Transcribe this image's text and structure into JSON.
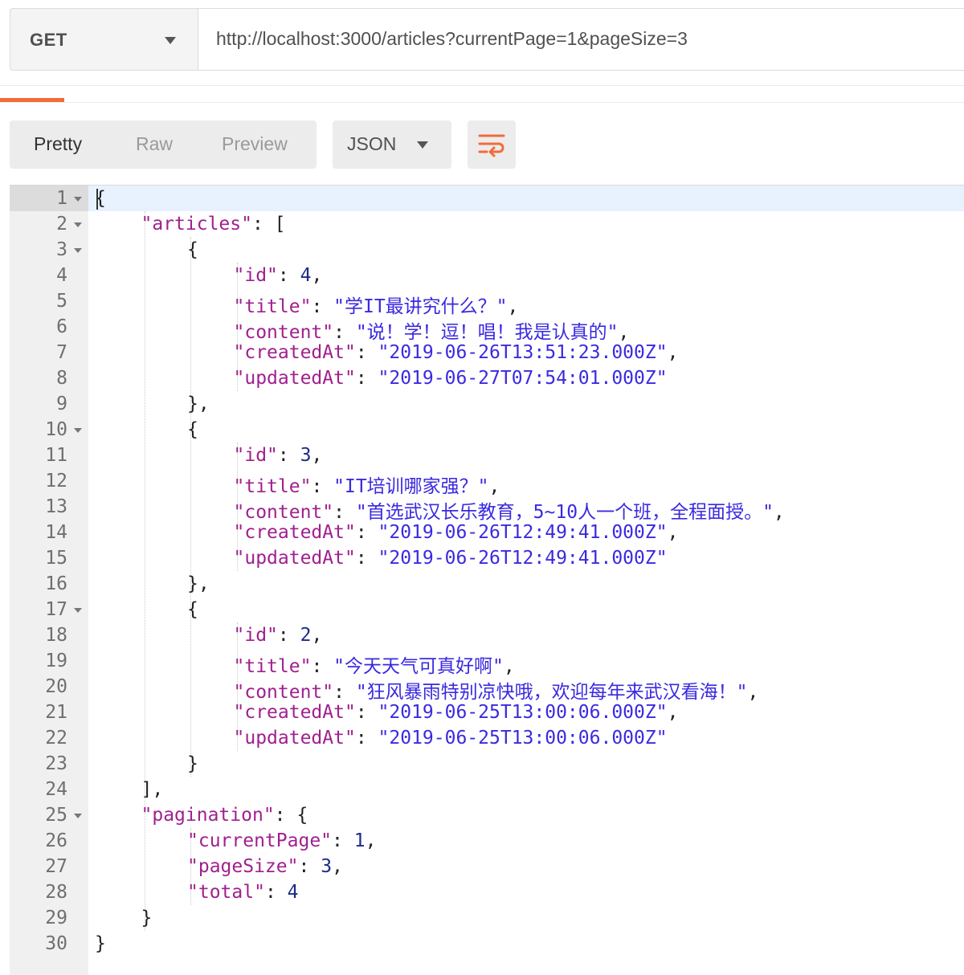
{
  "request": {
    "method": "GET",
    "url": "http://localhost:3000/articles?currentPage=1&pageSize=3"
  },
  "view": {
    "modes": [
      "Pretty",
      "Raw",
      "Preview"
    ],
    "active_mode": "Pretty",
    "format": "JSON",
    "wrap_icon": "wrap-lines-icon"
  },
  "colors": {
    "accent": "#f26b3a",
    "key": "#a0208f",
    "string": "#3a2ae0",
    "number": "#1c2a8a"
  },
  "editor": {
    "lines": [
      {
        "n": "1",
        "fold": true,
        "indent": 0,
        "tokens": [
          [
            "p",
            "{"
          ]
        ]
      },
      {
        "n": "2",
        "fold": true,
        "indent": 1,
        "tokens": [
          [
            "k",
            "\"articles\""
          ],
          [
            "p",
            ": ["
          ]
        ]
      },
      {
        "n": "3",
        "fold": true,
        "indent": 2,
        "tokens": [
          [
            "p",
            "{"
          ]
        ]
      },
      {
        "n": "4",
        "fold": false,
        "indent": 3,
        "tokens": [
          [
            "k",
            "\"id\""
          ],
          [
            "p",
            ": "
          ],
          [
            "n",
            "4"
          ],
          [
            "p",
            ","
          ]
        ]
      },
      {
        "n": "5",
        "fold": false,
        "indent": 3,
        "tokens": [
          [
            "k",
            "\"title\""
          ],
          [
            "p",
            ": "
          ],
          [
            "s",
            "\"学IT最讲究什么？\""
          ],
          [
            "p",
            ","
          ]
        ]
      },
      {
        "n": "6",
        "fold": false,
        "indent": 3,
        "tokens": [
          [
            "k",
            "\"content\""
          ],
          [
            "p",
            ": "
          ],
          [
            "s",
            "\"说！学！逗！唱！我是认真的\""
          ],
          [
            "p",
            ","
          ]
        ]
      },
      {
        "n": "7",
        "fold": false,
        "indent": 3,
        "tokens": [
          [
            "k",
            "\"createdAt\""
          ],
          [
            "p",
            ": "
          ],
          [
            "s",
            "\"2019-06-26T13:51:23.000Z\""
          ],
          [
            "p",
            ","
          ]
        ]
      },
      {
        "n": "8",
        "fold": false,
        "indent": 3,
        "tokens": [
          [
            "k",
            "\"updatedAt\""
          ],
          [
            "p",
            ": "
          ],
          [
            "s",
            "\"2019-06-27T07:54:01.000Z\""
          ]
        ]
      },
      {
        "n": "9",
        "fold": false,
        "indent": 2,
        "tokens": [
          [
            "p",
            "},"
          ]
        ]
      },
      {
        "n": "10",
        "fold": true,
        "indent": 2,
        "tokens": [
          [
            "p",
            "{"
          ]
        ]
      },
      {
        "n": "11",
        "fold": false,
        "indent": 3,
        "tokens": [
          [
            "k",
            "\"id\""
          ],
          [
            "p",
            ": "
          ],
          [
            "n",
            "3"
          ],
          [
            "p",
            ","
          ]
        ]
      },
      {
        "n": "12",
        "fold": false,
        "indent": 3,
        "tokens": [
          [
            "k",
            "\"title\""
          ],
          [
            "p",
            ": "
          ],
          [
            "s",
            "\"IT培训哪家强？\""
          ],
          [
            "p",
            ","
          ]
        ]
      },
      {
        "n": "13",
        "fold": false,
        "indent": 3,
        "tokens": [
          [
            "k",
            "\"content\""
          ],
          [
            "p",
            ": "
          ],
          [
            "s",
            "\"首选武汉长乐教育，5~10人一个班，全程面授。\""
          ],
          [
            "p",
            ","
          ]
        ]
      },
      {
        "n": "14",
        "fold": false,
        "indent": 3,
        "tokens": [
          [
            "k",
            "\"createdAt\""
          ],
          [
            "p",
            ": "
          ],
          [
            "s",
            "\"2019-06-26T12:49:41.000Z\""
          ],
          [
            "p",
            ","
          ]
        ]
      },
      {
        "n": "15",
        "fold": false,
        "indent": 3,
        "tokens": [
          [
            "k",
            "\"updatedAt\""
          ],
          [
            "p",
            ": "
          ],
          [
            "s",
            "\"2019-06-26T12:49:41.000Z\""
          ]
        ]
      },
      {
        "n": "16",
        "fold": false,
        "indent": 2,
        "tokens": [
          [
            "p",
            "},"
          ]
        ]
      },
      {
        "n": "17",
        "fold": true,
        "indent": 2,
        "tokens": [
          [
            "p",
            "{"
          ]
        ]
      },
      {
        "n": "18",
        "fold": false,
        "indent": 3,
        "tokens": [
          [
            "k",
            "\"id\""
          ],
          [
            "p",
            ": "
          ],
          [
            "n",
            "2"
          ],
          [
            "p",
            ","
          ]
        ]
      },
      {
        "n": "19",
        "fold": false,
        "indent": 3,
        "tokens": [
          [
            "k",
            "\"title\""
          ],
          [
            "p",
            ": "
          ],
          [
            "s",
            "\"今天天气可真好啊\""
          ],
          [
            "p",
            ","
          ]
        ]
      },
      {
        "n": "20",
        "fold": false,
        "indent": 3,
        "tokens": [
          [
            "k",
            "\"content\""
          ],
          [
            "p",
            ": "
          ],
          [
            "s",
            "\"狂风暴雨特别凉快哦，欢迎每年来武汉看海！\""
          ],
          [
            "p",
            ","
          ]
        ]
      },
      {
        "n": "21",
        "fold": false,
        "indent": 3,
        "tokens": [
          [
            "k",
            "\"createdAt\""
          ],
          [
            "p",
            ": "
          ],
          [
            "s",
            "\"2019-06-25T13:00:06.000Z\""
          ],
          [
            "p",
            ","
          ]
        ]
      },
      {
        "n": "22",
        "fold": false,
        "indent": 3,
        "tokens": [
          [
            "k",
            "\"updatedAt\""
          ],
          [
            "p",
            ": "
          ],
          [
            "s",
            "\"2019-06-25T13:00:06.000Z\""
          ]
        ]
      },
      {
        "n": "23",
        "fold": false,
        "indent": 2,
        "tokens": [
          [
            "p",
            "}"
          ]
        ]
      },
      {
        "n": "24",
        "fold": false,
        "indent": 1,
        "tokens": [
          [
            "p",
            "],"
          ]
        ]
      },
      {
        "n": "25",
        "fold": true,
        "indent": 1,
        "tokens": [
          [
            "k",
            "\"pagination\""
          ],
          [
            "p",
            ": {"
          ]
        ]
      },
      {
        "n": "26",
        "fold": false,
        "indent": 2,
        "tokens": [
          [
            "k",
            "\"currentPage\""
          ],
          [
            "p",
            ": "
          ],
          [
            "n",
            "1"
          ],
          [
            "p",
            ","
          ]
        ]
      },
      {
        "n": "27",
        "fold": false,
        "indent": 2,
        "tokens": [
          [
            "k",
            "\"pageSize\""
          ],
          [
            "p",
            ": "
          ],
          [
            "n",
            "3"
          ],
          [
            "p",
            ","
          ]
        ]
      },
      {
        "n": "28",
        "fold": false,
        "indent": 2,
        "tokens": [
          [
            "k",
            "\"total\""
          ],
          [
            "p",
            ": "
          ],
          [
            "n",
            "4"
          ]
        ]
      },
      {
        "n": "29",
        "fold": false,
        "indent": 1,
        "tokens": [
          [
            "p",
            "}"
          ]
        ]
      },
      {
        "n": "30",
        "fold": false,
        "indent": 0,
        "tokens": [
          [
            "p",
            "}"
          ]
        ]
      }
    ]
  }
}
